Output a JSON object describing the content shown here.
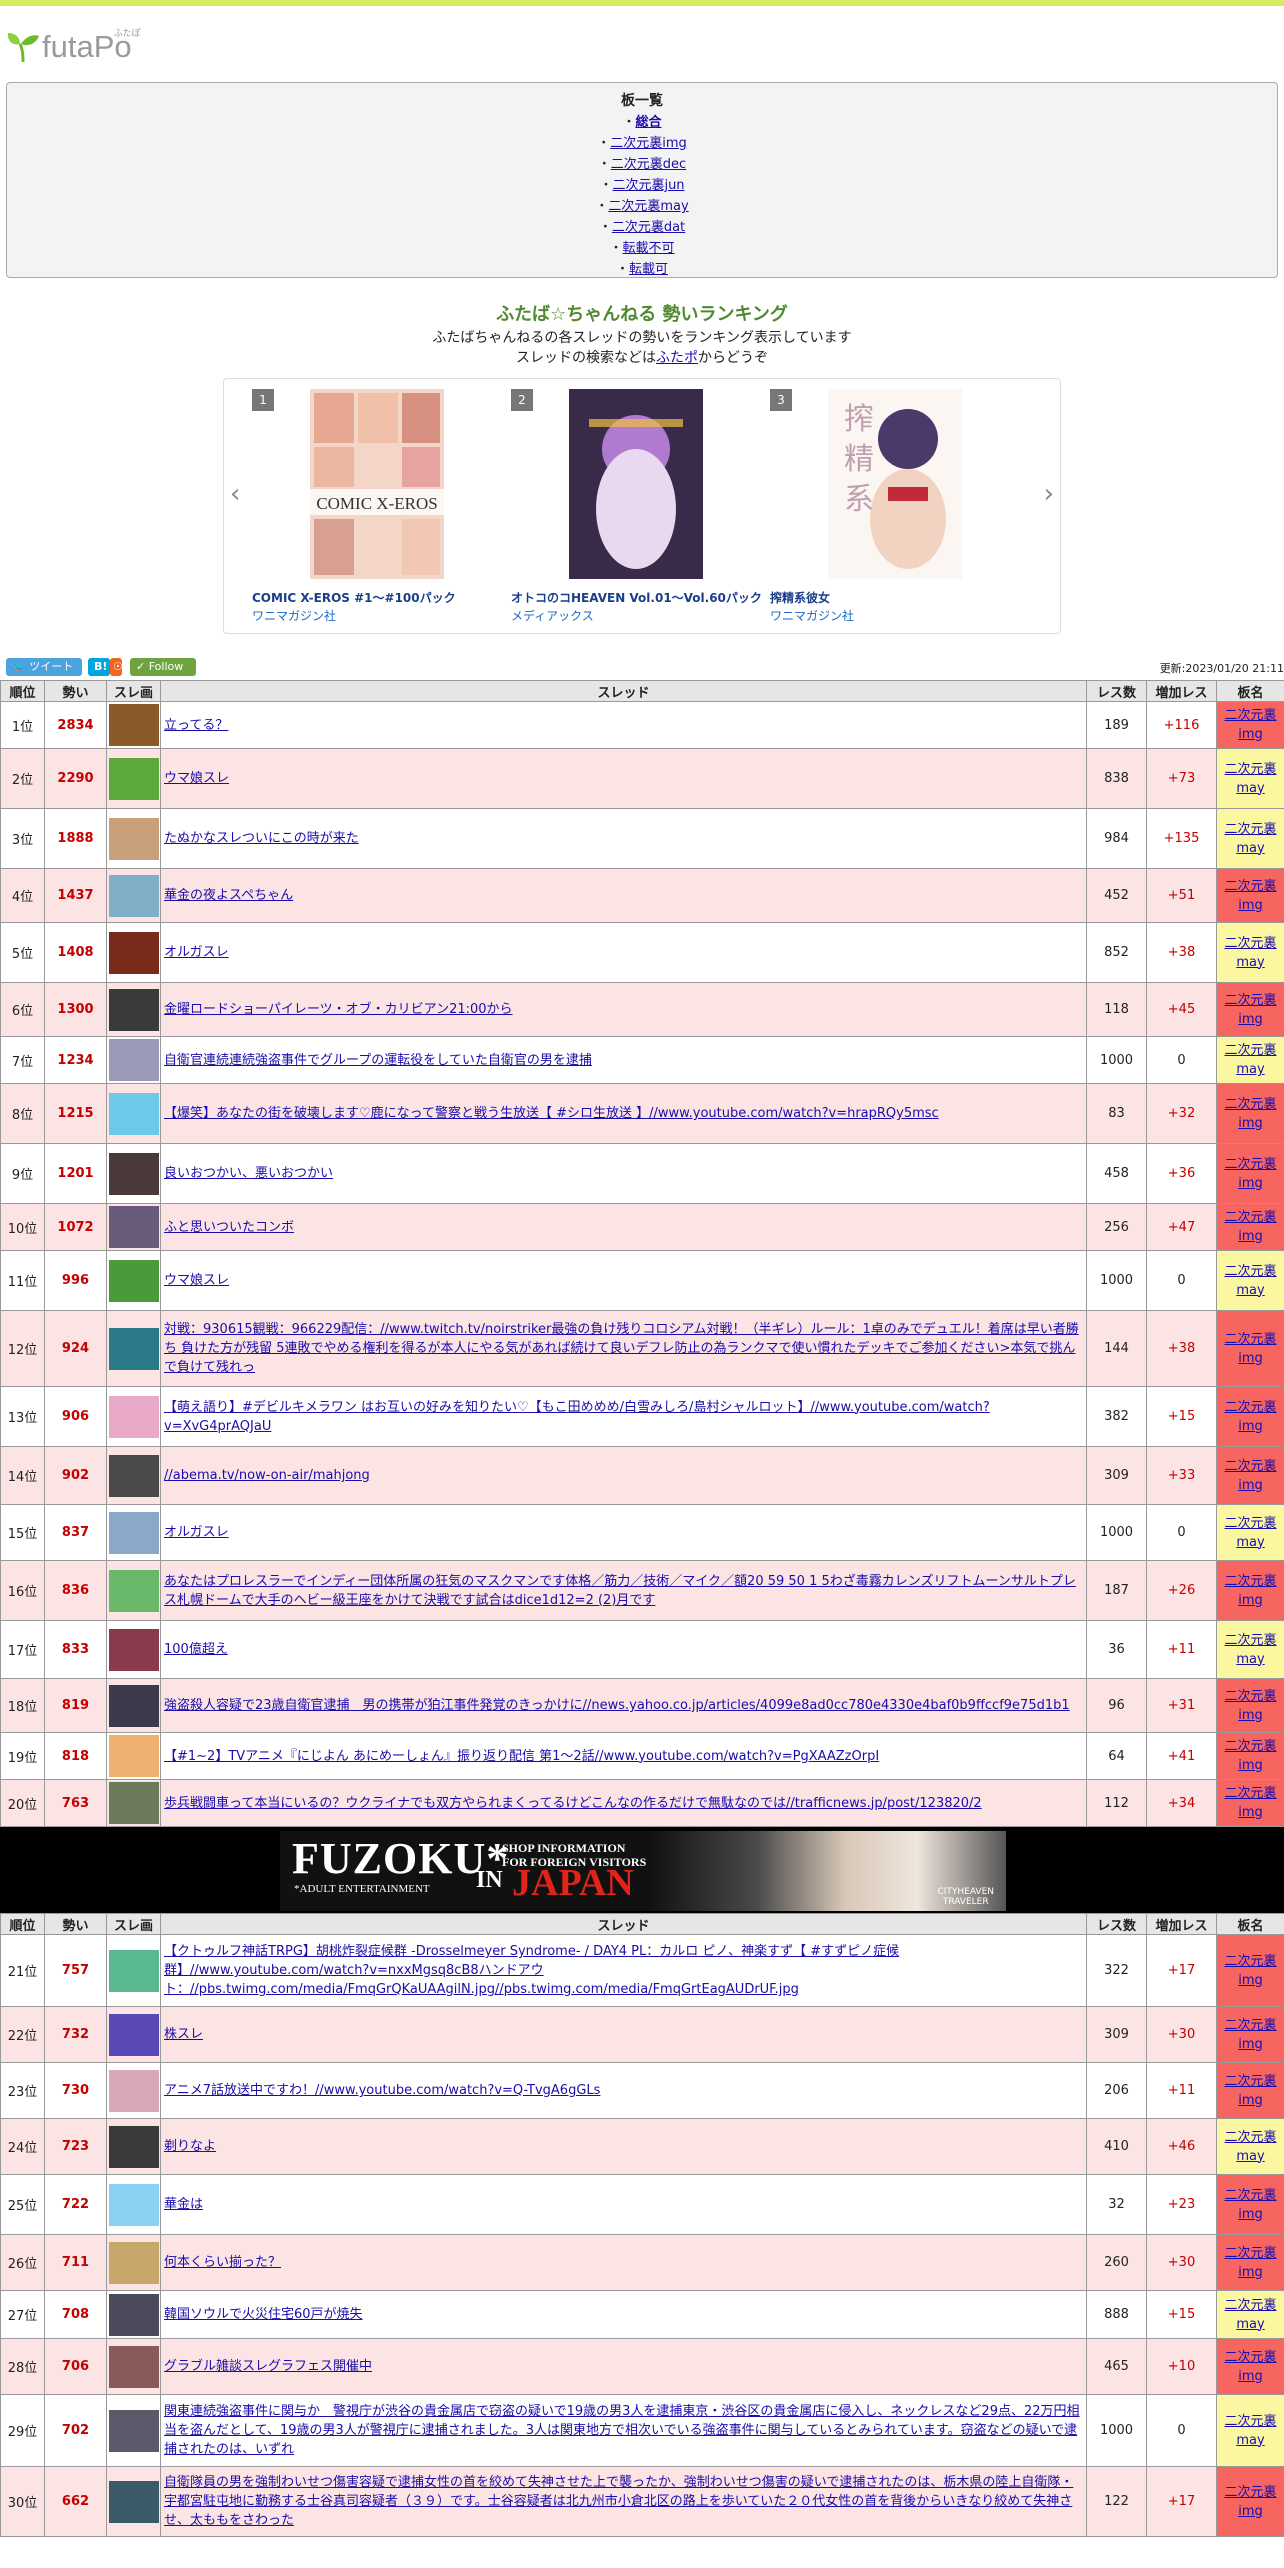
{
  "logo": {
    "text": "futaPo",
    "ruby": "ふたぽ"
  },
  "boards": {
    "title": "板一覧",
    "items": [
      {
        "label": "総合",
        "bold": true
      },
      {
        "label": "二次元裏img"
      },
      {
        "label": "二次元裏dec"
      },
      {
        "label": "二次元裏jun"
      },
      {
        "label": "二次元裏may"
      },
      {
        "label": "二次元裏dat"
      },
      {
        "label": "転載不可"
      },
      {
        "label": "転載可"
      }
    ]
  },
  "ranking": {
    "title": "ふたば☆ちゃんねる 勢いランキング",
    "desc1": "ふたばちゃんねるの各スレッドの勢いをランキング表示しています",
    "desc2_pre": "スレッドの検索などは",
    "desc2_link": "ふたポ",
    "desc2_post": "からどうぞ"
  },
  "carousel": {
    "items": [
      {
        "num": "1",
        "title": "COMIC X-EROS #1～#100パック",
        "publisher": "ワニマガジン社"
      },
      {
        "num": "2",
        "title": "オトコのコHEAVEN Vol.01～Vol.60パック",
        "publisher": "メディアックス"
      },
      {
        "num": "3",
        "title": "搾精系彼女",
        "publisher": "ワニマガジン社"
      }
    ]
  },
  "social": {
    "tweet": "ツイート",
    "hatena": "B!",
    "follow": "Follow"
  },
  "updated": "更新:2023/01/20 21:11",
  "table": {
    "headers": [
      "順位",
      "勢い",
      "スレ画",
      "スレッド",
      "レス数",
      "増加レス",
      "板名"
    ],
    "rows1": [
      {
        "rank": "1位",
        "mom": "2834",
        "title": "立ってる？",
        "res": "189",
        "inc": "+116",
        "board": "img",
        "color": "#8a5a2a"
      },
      {
        "rank": "2位",
        "mom": "2290",
        "title": "ウマ娘スレ",
        "res": "838",
        "inc": "+73",
        "board": "may",
        "color": "#5ca83a"
      },
      {
        "rank": "3位",
        "mom": "1888",
        "title": "たぬかなスレついにこの時が来た",
        "res": "984",
        "inc": "+135",
        "board": "may",
        "color": "#c9a07a"
      },
      {
        "rank": "4位",
        "mom": "1437",
        "title": "華金の夜よスペちゃん",
        "res": "452",
        "inc": "+51",
        "board": "img",
        "color": "#7fb0c8"
      },
      {
        "rank": "5位",
        "mom": "1408",
        "title": "オルガスレ",
        "res": "852",
        "inc": "+38",
        "board": "may",
        "color": "#7a2a1a"
      },
      {
        "rank": "6位",
        "mom": "1300",
        "title": "金曜ロードショーパイレーツ・オブ・カリビアン21:00から",
        "res": "118",
        "inc": "+45",
        "board": "img",
        "color": "#3a3a3a"
      },
      {
        "rank": "7位",
        "mom": "1234",
        "title": "自衛官連続連続強盗事件でグループの運転役をしていた自衛官の男を逮捕",
        "res": "1000",
        "inc": "0",
        "board": "may",
        "color": "#9a9ab8"
      },
      {
        "rank": "8位",
        "mom": "1215",
        "title": "【爆笑】あなたの街を破壊します♡鹿になって警察と戦う生放送【 #シロ生放送 】//www.youtube.com/watch?v=hrapRQy5msc",
        "res": "83",
        "inc": "+32",
        "board": "img",
        "color": "#6ec8e8"
      },
      {
        "rank": "9位",
        "mom": "1201",
        "title": "良いおつかい、悪いおつかい",
        "res": "458",
        "inc": "+36",
        "board": "img",
        "color": "#4a3a3a"
      },
      {
        "rank": "10位",
        "mom": "1072",
        "title": "ふと思いついたコンボ",
        "res": "256",
        "inc": "+47",
        "board": "img",
        "color": "#6a5a7a"
      },
      {
        "rank": "11位",
        "mom": "996",
        "title": "ウマ娘スレ",
        "res": "1000",
        "inc": "0",
        "board": "may",
        "color": "#4a9a3a"
      },
      {
        "rank": "12位",
        "mom": "924",
        "title": "対戦：930615観戦：966229配信：//www.twitch.tv/noirstriker最強の負け残りコロシアム対戦！（半ギレ）ルール：1卓のみでデュエル！着席は早い者勝ち 負けた方が残留 5連敗でやめる権利を得るが本人にやる気があれば続けて良いデフレ防止の為ランクマで使い慣れたデッキでご参加ください>本気で挑んで負けて残れっ",
        "res": "144",
        "inc": "+38",
        "board": "img",
        "color": "#2a7a8a"
      },
      {
        "rank": "13位",
        "mom": "906",
        "title": "【萌え語り】#デビルキメラワン はお互いの好みを知りたい♡【もこ田めめめ/白雪みしろ/島村シャルロット】//www.youtube.com/watch?v=XvG4prAQJaU",
        "res": "382",
        "inc": "+15",
        "board": "img",
        "color": "#e8a8c8"
      },
      {
        "rank": "14位",
        "mom": "902",
        "title": "//abema.tv/now-on-air/mahjong",
        "res": "309",
        "inc": "+33",
        "board": "img",
        "color": "#4a4a4a"
      },
      {
        "rank": "15位",
        "mom": "837",
        "title": "オルガスレ",
        "res": "1000",
        "inc": "0",
        "board": "may",
        "color": "#8aa8c8"
      },
      {
        "rank": "16位",
        "mom": "836",
        "title": "あなたはプロレスラーでインディー団体所属の狂気のマスクマンです体格／筋力／技術／マイク／額20 59 50 1 5わざ毒霧カレンズリフトムーンサルトプレス札幌ドームで大手のヘビー級王座をかけて決戦です試合はdice1d12=2 (2)月です",
        "res": "187",
        "inc": "+26",
        "board": "img",
        "color": "#6ab86a"
      },
      {
        "rank": "17位",
        "mom": "833",
        "title": "100億超え",
        "res": "36",
        "inc": "+11",
        "board": "may",
        "color": "#8a3a4a"
      },
      {
        "rank": "18位",
        "mom": "819",
        "title": "強盗殺人容疑で23歳自衛官逮捕　男の携帯が狛江事件発覚のきっかけに//news.yahoo.co.jp/articles/4099e8ad0cc780e4330e4baf0b9ffccf9e75d1b1",
        "res": "96",
        "inc": "+31",
        "board": "img",
        "color": "#3a3a4a"
      },
      {
        "rank": "19位",
        "mom": "818",
        "title": "【#1~2】TVアニメ『にじよん あにめーしょん』振り返り配信 第1～2話//www.youtube.com/watch?v=PgXAAZzOrpI",
        "res": "64",
        "inc": "+41",
        "board": "img",
        "color": "#f0b070"
      },
      {
        "rank": "20位",
        "mom": "763",
        "title": "歩兵戦闘車って本当にいるの？ウクライナでも双方やられまくってるけどこんなの作るだけで無駄なのでは//trafficnews.jp/post/123820/2",
        "res": "112",
        "inc": "+34",
        "board": "img",
        "color": "#6a7a5a"
      }
    ],
    "rows2": [
      {
        "rank": "21位",
        "mom": "757",
        "title": "【クトゥルフ神話TRPG】胡桃炸裂症候群 -Drosselmeyer Syndrome- / DAY4 PL：カルロ ピノ、神楽すず【 #すずピノ症候群】//www.youtube.com/watch?v=nxxMgsq8cB8ハンドアウト：//pbs.twimg.com/media/FmqGrQKaUAAgilN.jpg//pbs.twimg.com/media/FmqGrtEagAUDrUF.jpg",
        "res": "322",
        "inc": "+17",
        "board": "img",
        "color": "#5ab890"
      },
      {
        "rank": "22位",
        "mom": "732",
        "title": "株スレ",
        "res": "309",
        "inc": "+30",
        "board": "img",
        "color": "#5a4ab8"
      },
      {
        "rank": "23位",
        "mom": "730",
        "title": "アニメ7話放送中ですわ！//www.youtube.com/watch?v=Q-TvgA6gGLs",
        "res": "206",
        "inc": "+11",
        "board": "img",
        "color": "#d8a8b8"
      },
      {
        "rank": "24位",
        "mom": "723",
        "title": "剃りなよ",
        "res": "410",
        "inc": "+46",
        "board": "may",
        "color": "#3a3a3a"
      },
      {
        "rank": "25位",
        "mom": "722",
        "title": "華金は",
        "res": "32",
        "inc": "+23",
        "board": "img",
        "color": "#8ad0f0"
      },
      {
        "rank": "26位",
        "mom": "711",
        "title": "何本くらい揃った？",
        "res": "260",
        "inc": "+30",
        "board": "img",
        "color": "#c8a86a"
      },
      {
        "rank": "27位",
        "mom": "708",
        "title": "韓国ソウルで火災住宅60戸が焼失",
        "res": "888",
        "inc": "+15",
        "board": "may",
        "color": "#4a4a5a"
      },
      {
        "rank": "28位",
        "mom": "706",
        "title": "グラブル雑談スレグラフェス開催中",
        "res": "465",
        "inc": "+10",
        "board": "img",
        "color": "#8a5a5a"
      },
      {
        "rank": "29位",
        "mom": "702",
        "title": "関東連続強盗事件に関与か　警視庁が渋谷の貴金属店で窃盗の疑いで19歳の男3人を逮捕東京・渋谷区の貴金属店に侵入し、ネックレスなど29点、22万円相当を盗んだとして、19歳の男3人が警視庁に逮捕されました。3人は関東地方で相次いでいる強盗事件に関与しているとみられています。窃盗などの疑いで逮捕されたのは、いずれ",
        "res": "1000",
        "inc": "0",
        "board": "may",
        "color": "#5a5a6a"
      },
      {
        "rank": "30位",
        "mom": "662",
        "title": "自衛隊員の男を強制わいせつ傷害容疑で逮捕女性の首を絞めて失神させた上で襲ったか、強制わいせつ傷害の疑いで逮捕されたのは、栃木県の陸上自衛隊・宇都宮駐屯地に勤務する士谷真司容疑者（３９）です。士谷容疑者は北九州市小倉北区の路上を歩いていた２０代女性の首を背後からいきなり絞めて失神させ、太ももをさわった",
        "res": "122",
        "inc": "+17",
        "board": "img",
        "color": "#3a5a6a"
      }
    ]
  },
  "banner": {
    "title": "FUZOKU",
    "star": "*",
    "shop": "SHOP INFORMATION",
    "foreign": "FOR FOREIGN VISITORS",
    "in": "IN",
    "japan": "JAPAN",
    "adult": "*ADULT ENTERTAINMENT",
    "traveler1": "CITYHEAVEN",
    "traveler2": "TRAVELER"
  },
  "board_prefix": "二次元裏"
}
